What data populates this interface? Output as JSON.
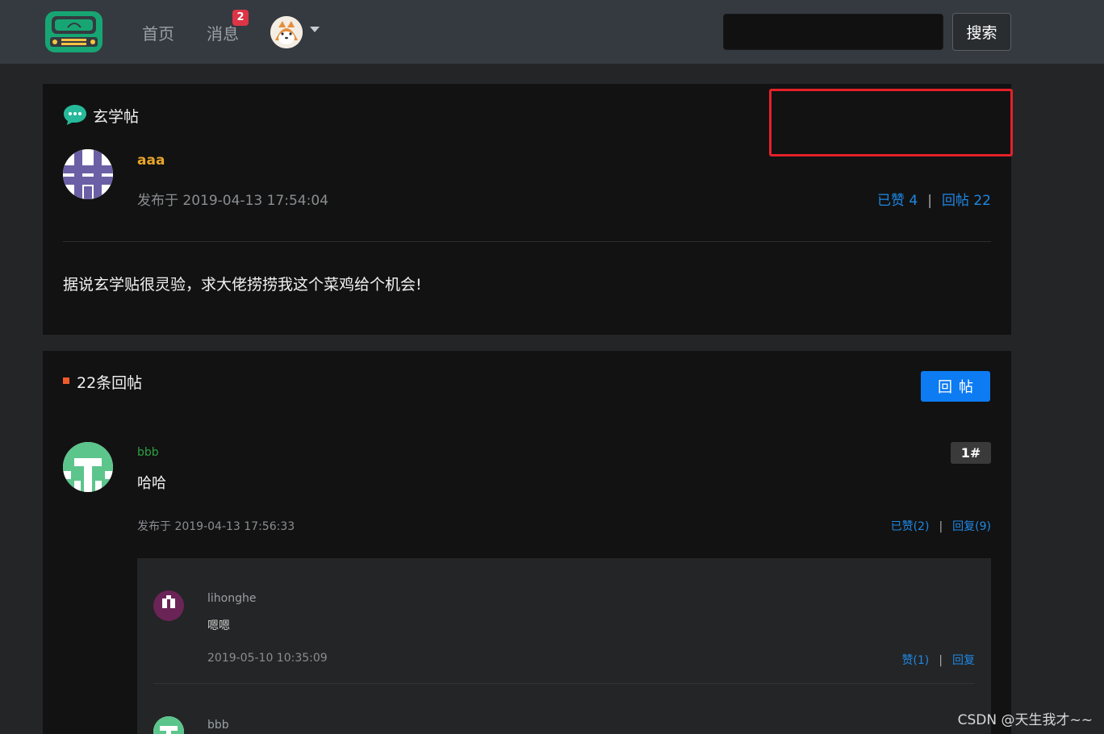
{
  "header": {
    "logo_icon": "car-logo-icon",
    "nav": {
      "home_label": "首页",
      "messages_label": "消息",
      "messages_badge": "2"
    },
    "user_menu_icon": "chevron-down-icon",
    "search": {
      "placeholder": "",
      "button_label": "搜索"
    }
  },
  "post": {
    "title": "玄学帖",
    "author": "aaa",
    "published": "发布于 2019-04-13 17:54:04",
    "liked_label": "已赞 4",
    "reply_label": "回帖 22",
    "content": "据说玄学贴很灵验，求大佬捞捞我这个菜鸡给个机会!"
  },
  "replies": {
    "count_label": "22条回帖",
    "reply_button_label": "回帖",
    "items": [
      {
        "author": "bbb",
        "floor": "1#",
        "content": "哈哈",
        "published": "发布于 2019-04-13 17:56:33",
        "liked_label": "已赞(2)",
        "reply_label": "回复(9)",
        "sub_replies": [
          {
            "author": "lihonghe",
            "content": "嗯嗯",
            "time": "2019-05-10 10:35:09",
            "like_label": "赞(1)",
            "reply_label": "回复"
          },
          {
            "author": "bbb"
          }
        ]
      }
    ]
  },
  "separator": "|",
  "watermark": "CSDN @天生我才~~",
  "colors": {
    "accent": "#0d7bf2",
    "link": "#1e88e5",
    "author": "#e8a52a",
    "reply_author": "#2ea043",
    "highlight_box": "#e5202a",
    "badge": "#dc3545"
  }
}
